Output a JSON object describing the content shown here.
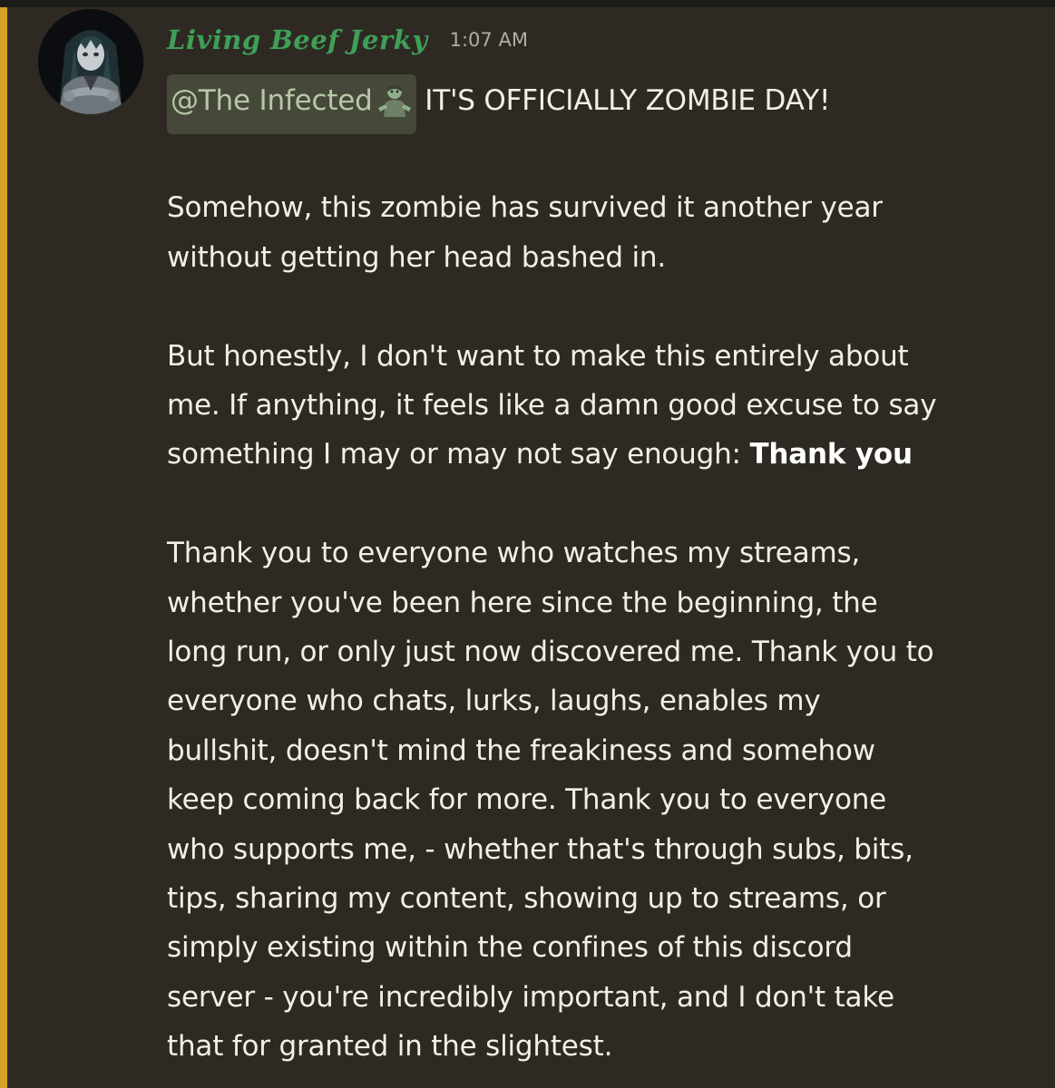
{
  "message": {
    "author": "Living Beef Jerky",
    "timestamp": "1:07 AM",
    "mention": "@The Infected",
    "mention_emoji": "zombie-emoji",
    "first_line_after_mention": "IT'S OFFICIALLY ZOMBIE DAY!",
    "paragraph2": [
      "Somehow, this zombie has survived it another year",
      "without getting her head bashed in."
    ],
    "paragraph3": [
      "But honestly, I don't want to make this entirely about",
      "me. If anything, it feels like a damn good excuse to say"
    ],
    "paragraph3_last_prefix": "something I may or may not say enough: ",
    "paragraph3_bold": "Thank you",
    "paragraph4": [
      "Thank you to everyone who watches my streams,",
      "whether you've been here since the beginning, the",
      "long run, or only just now discovered me. Thank you to",
      "everyone who chats, lurks, laughs, enables my",
      "bullshit, doesn't mind the freakiness and somehow",
      "keep coming back for more. Thank you to everyone",
      "who supports me, - whether that's through subs, bits,",
      "tips, sharing my content, showing up to streams, or",
      "simply existing within the confines of this discord",
      "server - you're incredibly important, and I don't take",
      "that for granted in the slightest."
    ]
  },
  "colors": {
    "background": "#2e2a23",
    "highlight_bar": "#d4a42a",
    "username": "#3f9f58",
    "text": "#f2efe8",
    "mention_bg": "#46493a",
    "mention_text": "#b7c7a7"
  }
}
